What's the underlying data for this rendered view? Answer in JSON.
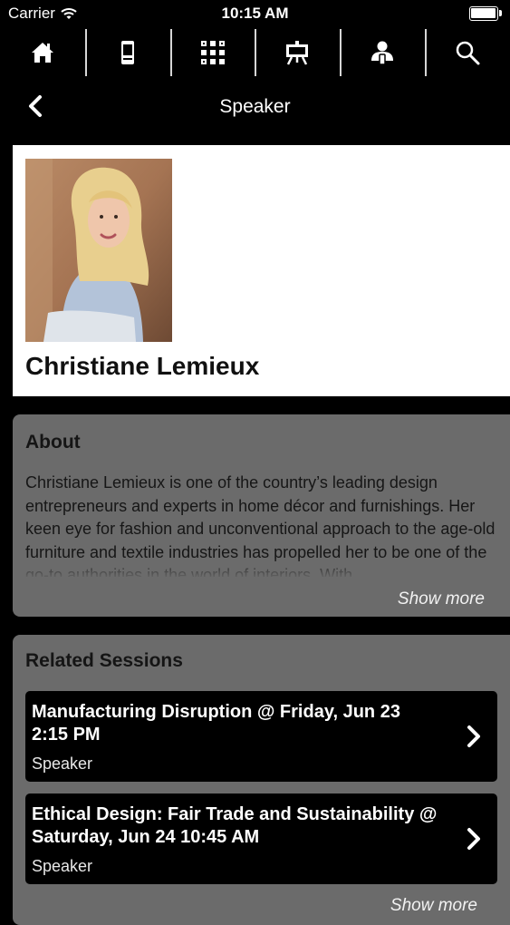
{
  "status_bar": {
    "carrier": "Carrier",
    "time": "10:15 AM"
  },
  "nav": {
    "items": [
      {
        "icon": "home-icon"
      },
      {
        "icon": "phone-icon"
      },
      {
        "icon": "qr-code-icon"
      },
      {
        "icon": "presentation-board-icon"
      },
      {
        "icon": "speaker-person-icon"
      },
      {
        "icon": "search-icon"
      }
    ]
  },
  "header": {
    "title": "Speaker"
  },
  "speaker": {
    "name": "Christiane Lemieux"
  },
  "about": {
    "heading": "About",
    "text": "Christiane Lemieux is one of the country’s leading design entrepreneurs and experts in home décor and furnishings. Her keen eye for fashion and unconventional approach to the age-old furniture and textile industries has propelled her to be one of the go-to authorities in the world of interiors. With",
    "show_more": "Show more"
  },
  "related_sessions": {
    "heading": "Related Sessions",
    "sessions": [
      {
        "title": "Manufacturing Disruption @ Friday, Jun 23 2:15 PM",
        "role": "Speaker"
      },
      {
        "title": "Ethical Design: Fair Trade and Sustainability @ Saturday, Jun 24 10:45 AM",
        "role": "Speaker"
      }
    ],
    "show_more": "Show more"
  },
  "colors": {
    "background": "#000000",
    "panel": "#6b6b6b",
    "card": "#000000",
    "profile_card": "#ffffff"
  }
}
